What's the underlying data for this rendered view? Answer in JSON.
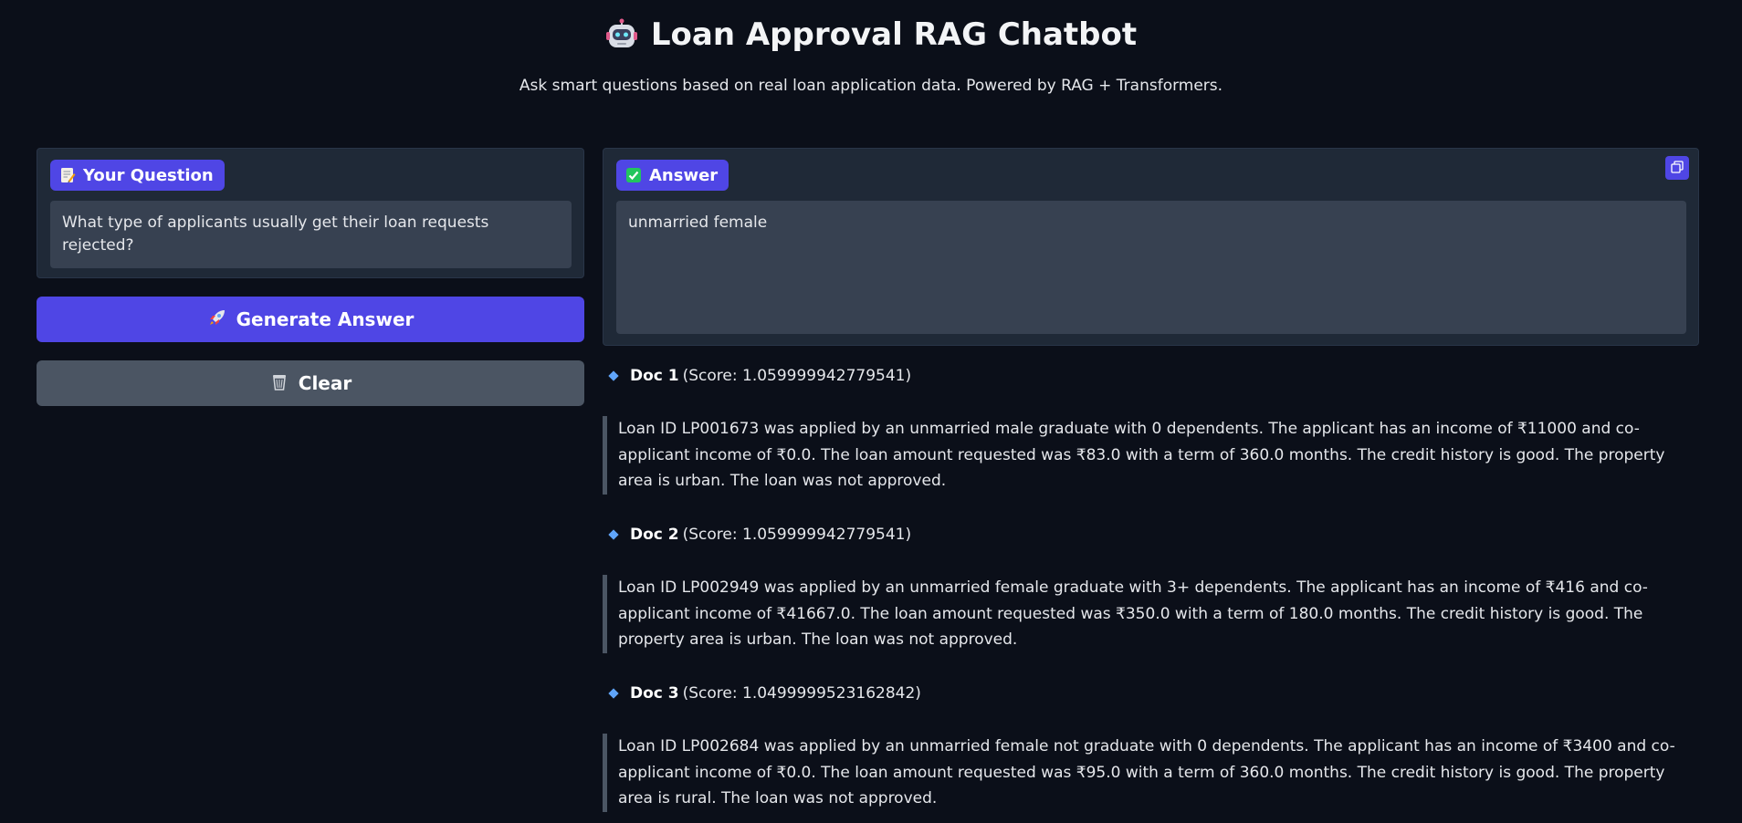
{
  "header": {
    "title": "Loan Approval RAG Chatbot",
    "subtitle": "Ask smart questions based on real loan application data. Powered by RAG + Transformers."
  },
  "question": {
    "label": "Your Question",
    "value": "What type of applicants usually get their loan requests rejected?"
  },
  "buttons": {
    "generate": "Generate Answer",
    "clear": "Clear"
  },
  "answer": {
    "label": "Answer",
    "value": "unmarried female"
  },
  "docs": [
    {
      "title": "Doc 1",
      "score": "(Score: 1.059999942779541)",
      "text": "Loan ID LP001673 was applied by an unmarried male graduate with 0 dependents. The applicant has an income of ₹11000 and co-applicant income of ₹0.0. The loan amount requested was ₹83.0 with a term of 360.0 months. The credit history is good. The property area is urban. The loan was not approved."
    },
    {
      "title": "Doc 2",
      "score": "(Score: 1.059999942779541)",
      "text": "Loan ID LP002949 was applied by an unmarried female graduate with 3+ dependents. The applicant has an income of ₹416 and co-applicant income of ₹41667.0. The loan amount requested was ₹350.0 with a term of 180.0 months. The credit history is good. The property area is urban. The loan was not approved."
    },
    {
      "title": "Doc 3",
      "score": "(Score: 1.0499999523162842)",
      "text": "Loan ID LP002684 was applied by an unmarried female not graduate with 0 dependents. The applicant has an income of ₹3400 and co-applicant income of ₹0.0. The loan amount requested was ₹95.0 with a term of 360.0 months. The credit history is good. The property area is rural. The loan was not approved."
    }
  ],
  "icons": {
    "title": "robot-icon",
    "question_label": "memo-icon",
    "answer_label": "check-mark-icon",
    "generate": "rocket-icon",
    "clear": "wastebasket-icon",
    "copy": "copy-icon",
    "doc_bullet": "blue-diamond-icon"
  },
  "colors": {
    "background": "#0b0f19",
    "panel": "#1f2937",
    "field": "#374151",
    "accent": "#4f46e5",
    "secondary_button": "#4b5563",
    "diamond": "#60a5fa"
  }
}
